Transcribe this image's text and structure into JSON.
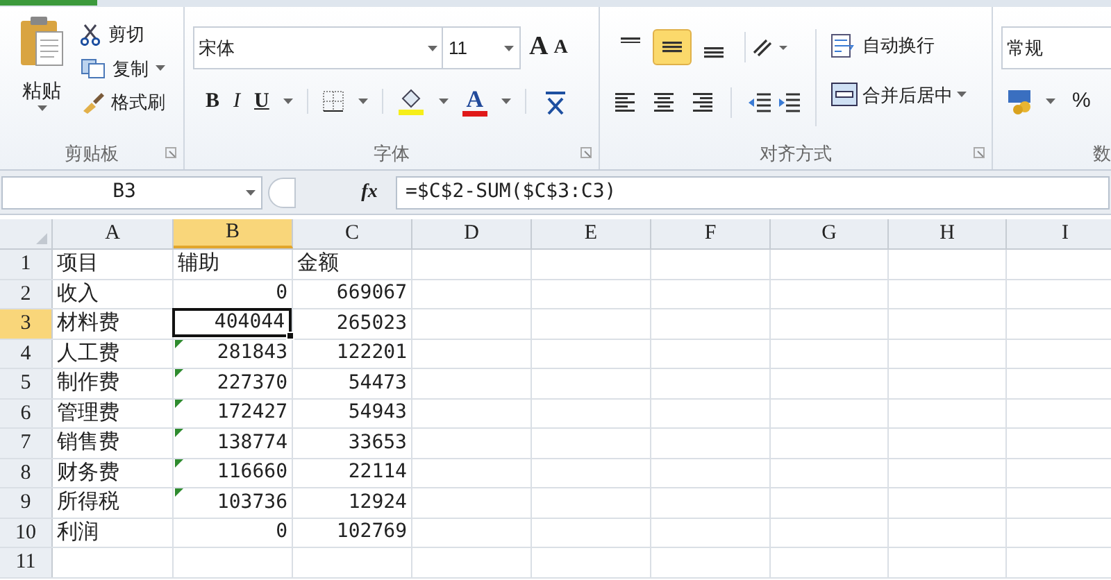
{
  "ribbon": {
    "clipboard": {
      "paste": "粘贴",
      "cut": "剪切",
      "copy": "复制",
      "format_painter": "格式刷",
      "label": "剪贴板"
    },
    "font": {
      "font_name": "宋体",
      "font_size": "11",
      "grow": "A",
      "shrink": "A",
      "bold": "B",
      "italic": "I",
      "underline": "U",
      "font_color": "A",
      "label": "字体"
    },
    "alignment": {
      "vertical": [
        {
          "kind": "top",
          "selected": false
        },
        {
          "kind": "middle",
          "selected": true
        },
        {
          "kind": "bottom",
          "selected": false
        }
      ],
      "wrap": "自动换行",
      "merge": "合并后居中",
      "label": "对齐方式"
    },
    "number": {
      "format": "常规",
      "percent": "%",
      "label": "数"
    }
  },
  "name_box": "B3",
  "fx": "fx",
  "formula": "=$C$2-SUM($C$3:C3)",
  "columns": [
    {
      "label": "A",
      "selected": false
    },
    {
      "label": "B",
      "selected": true
    },
    {
      "label": "C",
      "selected": false
    },
    {
      "label": "D",
      "selected": false
    },
    {
      "label": "E",
      "selected": false
    },
    {
      "label": "F",
      "selected": false
    },
    {
      "label": "G",
      "selected": false
    },
    {
      "label": "H",
      "selected": false
    },
    {
      "label": "I",
      "selected": false
    }
  ],
  "rows": [
    {
      "number": "1",
      "selected": false,
      "cells": [
        {
          "value": "项目",
          "kind": "text"
        },
        {
          "value": "辅助",
          "kind": "text",
          "selected": false,
          "flagged": false
        },
        {
          "value": "金额",
          "kind": "text"
        }
      ]
    },
    {
      "number": "2",
      "selected": false,
      "cells": [
        {
          "value": "收入",
          "kind": "text"
        },
        {
          "value": "0",
          "kind": "number",
          "selected": false,
          "flagged": false
        },
        {
          "value": "669067",
          "kind": "number"
        }
      ]
    },
    {
      "number": "3",
      "selected": true,
      "cells": [
        {
          "value": "材料费",
          "kind": "text"
        },
        {
          "value": "404044",
          "kind": "number",
          "selected": true,
          "flagged": false
        },
        {
          "value": "265023",
          "kind": "number"
        }
      ]
    },
    {
      "number": "4",
      "selected": false,
      "cells": [
        {
          "value": "人工费",
          "kind": "text"
        },
        {
          "value": "281843",
          "kind": "number",
          "selected": false,
          "flagged": true
        },
        {
          "value": "122201",
          "kind": "number"
        }
      ]
    },
    {
      "number": "5",
      "selected": false,
      "cells": [
        {
          "value": "制作费",
          "kind": "text"
        },
        {
          "value": "227370",
          "kind": "number",
          "selected": false,
          "flagged": true
        },
        {
          "value": "54473",
          "kind": "number"
        }
      ]
    },
    {
      "number": "6",
      "selected": false,
      "cells": [
        {
          "value": "管理费",
          "kind": "text"
        },
        {
          "value": "172427",
          "kind": "number",
          "selected": false,
          "flagged": true
        },
        {
          "value": "54943",
          "kind": "number"
        }
      ]
    },
    {
      "number": "7",
      "selected": false,
      "cells": [
        {
          "value": "销售费",
          "kind": "text"
        },
        {
          "value": "138774",
          "kind": "number",
          "selected": false,
          "flagged": true
        },
        {
          "value": "33653",
          "kind": "number"
        }
      ]
    },
    {
      "number": "8",
      "selected": false,
      "cells": [
        {
          "value": "财务费",
          "kind": "text"
        },
        {
          "value": "116660",
          "kind": "number",
          "selected": false,
          "flagged": true
        },
        {
          "value": "22114",
          "kind": "number"
        }
      ]
    },
    {
      "number": "9",
      "selected": false,
      "cells": [
        {
          "value": "所得税",
          "kind": "text"
        },
        {
          "value": "103736",
          "kind": "number",
          "selected": false,
          "flagged": true
        },
        {
          "value": "12924",
          "kind": "number"
        }
      ]
    },
    {
      "number": "10",
      "selected": false,
      "cells": [
        {
          "value": "利润",
          "kind": "text"
        },
        {
          "value": "0",
          "kind": "number",
          "selected": false,
          "flagged": false
        },
        {
          "value": "102769",
          "kind": "number"
        }
      ]
    },
    {
      "number": "11",
      "selected": false,
      "cells": []
    }
  ]
}
